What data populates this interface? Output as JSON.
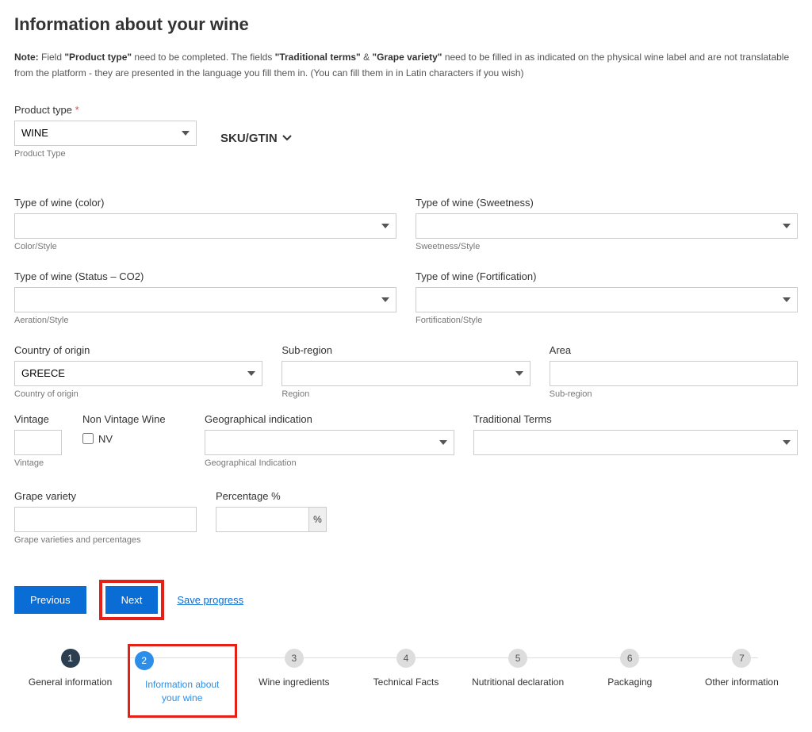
{
  "header": {
    "title": "Information about your wine"
  },
  "note": {
    "label": "Note:",
    "text1": " Field ",
    "b1": "\"Product type\"",
    "text2": " need to be completed. The fields ",
    "b2": "\"Traditional terms\"",
    "text3": " & ",
    "b3": "\"Grape variety\"",
    "text4": " need to be filled in as indicated on the physical wine label and are not translatable from the platform - they are presented in the language you fill them in. (You can fill them in in Latin characters if you wish)"
  },
  "product_type": {
    "label": "Product type",
    "value": "WINE",
    "helper": "Product Type"
  },
  "sku_gtin": {
    "label": "SKU/GTIN"
  },
  "type_color": {
    "label": "Type of wine (color)",
    "helper": "Color/Style"
  },
  "type_sweetness": {
    "label": "Type of wine (Sweetness)",
    "helper": "Sweetness/Style"
  },
  "type_status": {
    "label": "Type of wine (Status – CO2)",
    "helper": "Aeration/Style"
  },
  "type_fort": {
    "label": "Type of wine (Fortification)",
    "helper": "Fortification/Style"
  },
  "country": {
    "label": "Country of origin",
    "value": "GREECE",
    "helper": "Country of origin"
  },
  "subregion": {
    "label": "Sub-region",
    "helper": "Region"
  },
  "area": {
    "label": "Area",
    "helper": "Sub-region"
  },
  "vintage": {
    "label": "Vintage",
    "helper": "Vintage"
  },
  "nv": {
    "label": "Non Vintage Wine",
    "check_label": "NV"
  },
  "geo": {
    "label": "Geographical indication",
    "helper": "Geographical Indication"
  },
  "trad": {
    "label": "Traditional Terms"
  },
  "grape": {
    "label": "Grape variety",
    "helper": "Grape varieties and percentages"
  },
  "pct": {
    "label": "Percentage %",
    "suffix": "%"
  },
  "actions": {
    "previous": "Previous",
    "next": "Next",
    "save": "Save progress"
  },
  "stepper": {
    "s1": {
      "num": "1",
      "label": "General information"
    },
    "s2": {
      "num": "2",
      "label": "Information about your wine"
    },
    "s3": {
      "num": "3",
      "label": "Wine ingredients"
    },
    "s4": {
      "num": "4",
      "label": "Technical Facts"
    },
    "s5": {
      "num": "5",
      "label": "Nutritional declaration"
    },
    "s6": {
      "num": "6",
      "label": "Packaging"
    },
    "s7": {
      "num": "7",
      "label": "Other information"
    }
  }
}
